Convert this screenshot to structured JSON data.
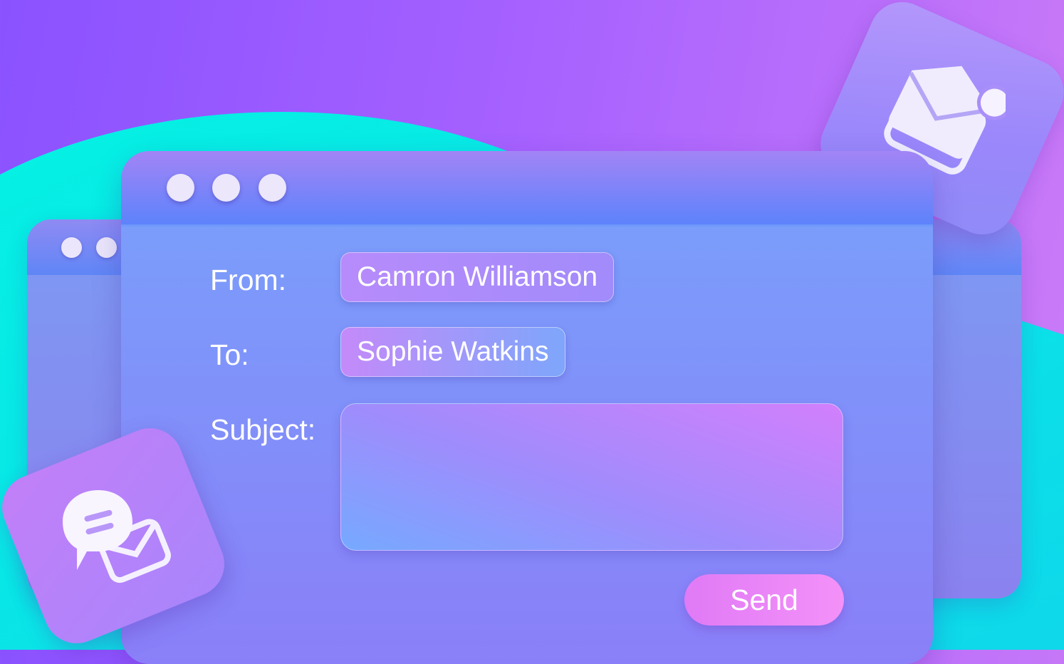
{
  "window": {
    "traffic_lights": [
      "dot",
      "dot",
      "dot"
    ]
  },
  "form": {
    "from_label": "From:",
    "from_value": "Camron Williamson",
    "to_label": "To:",
    "to_value": "Sophie Watkins",
    "subject_label": "Subject:",
    "subject_value": "",
    "send_label": "Send"
  },
  "icons": {
    "mail_app": "mail-notification-icon",
    "chat_app": "chat-mail-icon"
  },
  "colors": {
    "accent_cyan": "#04f0e2",
    "accent_purple": "#8a52ff",
    "send_button": "#e884f8"
  }
}
